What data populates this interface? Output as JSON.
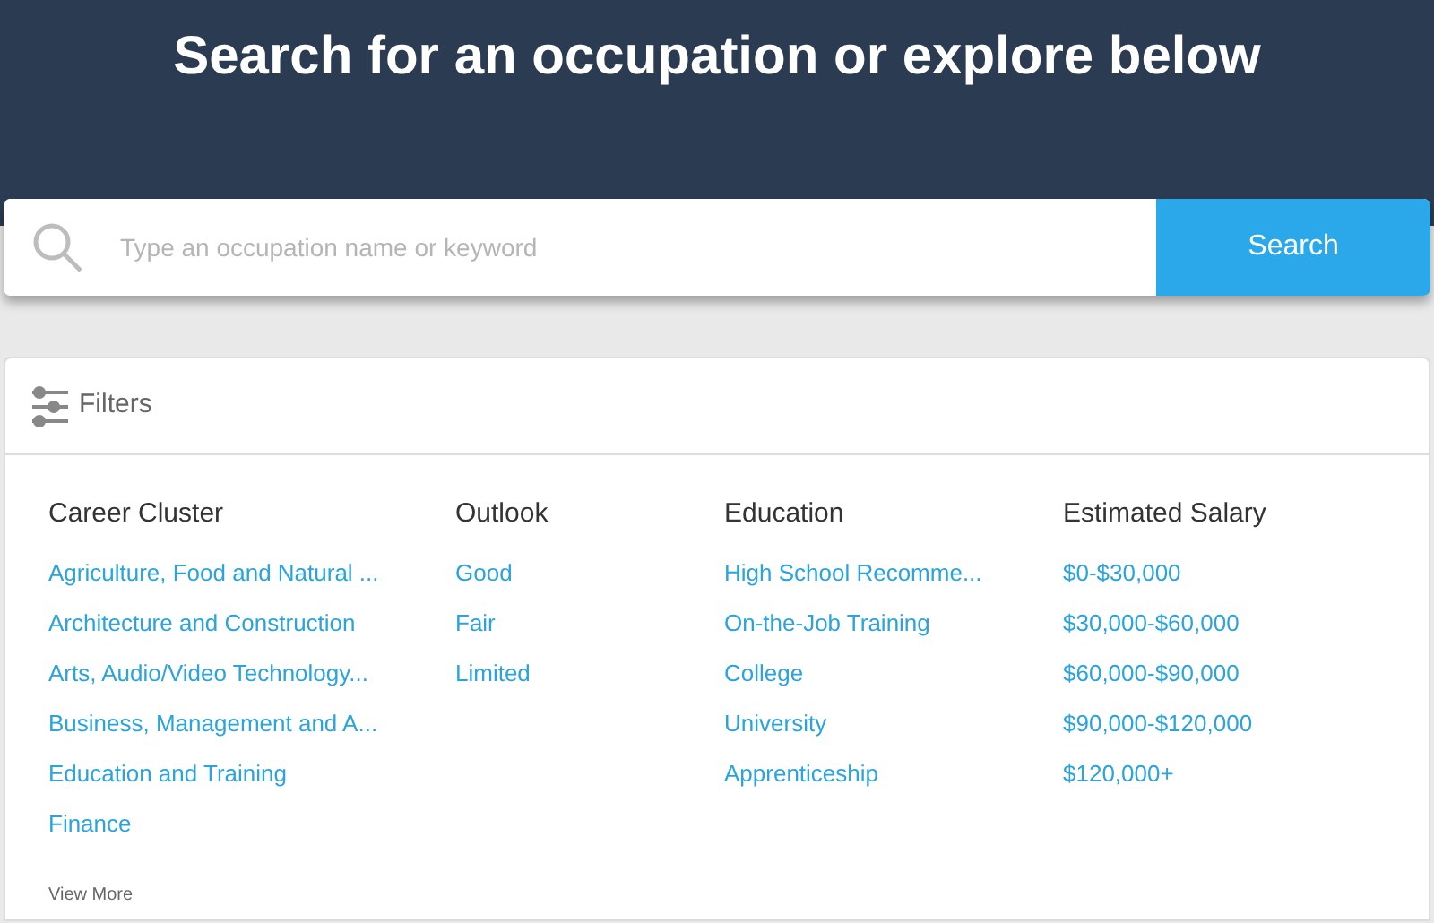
{
  "header": {
    "title": "Search for an occupation or explore below"
  },
  "search": {
    "placeholder": "Type an occupation name or keyword",
    "button": "Search"
  },
  "filters": {
    "title": "Filters",
    "columns": [
      {
        "heading": "Career Cluster",
        "items": [
          "Agriculture, Food and Natural ...",
          "Architecture and Construction",
          "Arts, Audio/Video Technology...",
          "Business, Management and A...",
          "Education and Training",
          "Finance"
        ]
      },
      {
        "heading": "Outlook",
        "items": [
          "Good",
          "Fair",
          "Limited"
        ]
      },
      {
        "heading": "Education",
        "items": [
          "High School Recomme...",
          "On-the-Job Training",
          "College",
          "University",
          "Apprenticeship"
        ]
      },
      {
        "heading": "Estimated Salary",
        "items": [
          "$0-$30,000",
          "$30,000-$60,000",
          "$60,000-$90,000",
          "$90,000-$120,000",
          "$120,000+"
        ]
      }
    ],
    "view_more": "View More"
  }
}
